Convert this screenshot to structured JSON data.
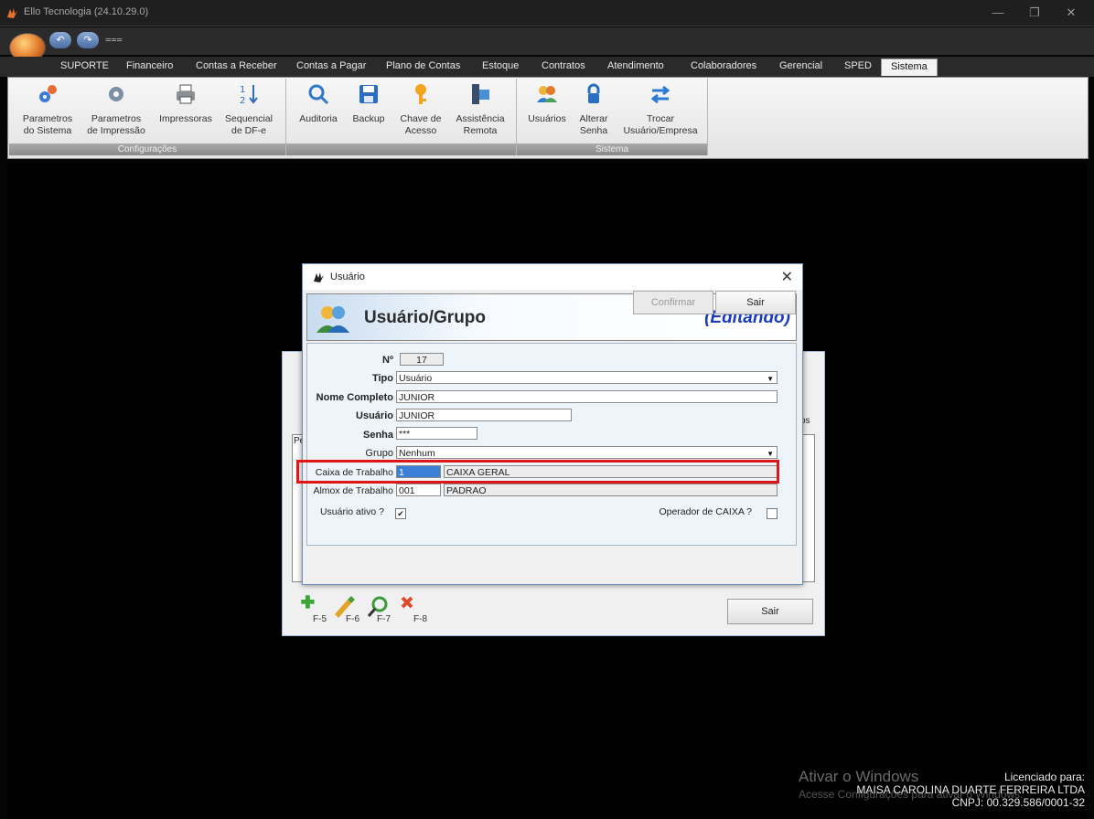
{
  "window": {
    "title": "Ello Tecnologia (24.10.29.0)",
    "minimize": "—",
    "restore": "❐",
    "close": "✕"
  },
  "qat": {
    "undo": "↶",
    "redo": "↷",
    "more": "⩶"
  },
  "tabs": [
    {
      "label": "SUPORTE"
    },
    {
      "label": "Financeiro"
    },
    {
      "label": "Contas a Receber"
    },
    {
      "label": "Contas a Pagar"
    },
    {
      "label": "Plano de Contas"
    },
    {
      "label": "Estoque"
    },
    {
      "label": "Contratos"
    },
    {
      "label": "Atendimento"
    },
    {
      "label": "Colaboradores"
    },
    {
      "label": "Gerencial"
    },
    {
      "label": "SPED"
    },
    {
      "label": "Sistema"
    }
  ],
  "ribbon": {
    "groups": [
      {
        "label": "Configurações"
      },
      {
        "label": ""
      },
      {
        "label": "Sistema"
      }
    ],
    "buttons": [
      {
        "line1": "Parametros",
        "line2": "do Sistema"
      },
      {
        "line1": "Parametros",
        "line2": "de Impressão"
      },
      {
        "line1": "Impressoras",
        "line2": ""
      },
      {
        "line1": "Sequencial",
        "line2": "de DF-e"
      },
      {
        "line1": "Auditoria",
        "line2": ""
      },
      {
        "line1": "Backup",
        "line2": ""
      },
      {
        "line1": "Chave de",
        "line2": "Acesso"
      },
      {
        "line1": "Assistência",
        "line2": "Remota"
      },
      {
        "line1": "Usuários",
        "line2": ""
      },
      {
        "line1": "Alterar",
        "line2": "Senha"
      },
      {
        "line1": "Trocar",
        "line2": "Usuário/Empresa"
      }
    ]
  },
  "background_window": {
    "keys": [
      "F-5",
      "F-6",
      "F-7",
      "F-8"
    ],
    "sair_label": "Sair",
    "partial_left": "Pe",
    "partial_right": "os"
  },
  "dialog": {
    "title": "Usuário",
    "close": "✕",
    "banner_title": "Usuário/Grupo",
    "banner_status": "(Editando)",
    "fields": {
      "numero_label": "Nº",
      "numero_value": "17",
      "tipo_label": "Tipo",
      "tipo_value": "Usuário",
      "nome_label": "Nome Completo",
      "nome_value": "JUNIOR",
      "usuario_label": "Usuário",
      "usuario_value": "JUNIOR",
      "senha_label": "Senha",
      "senha_value": "***",
      "grupo_label": "Grupo",
      "grupo_value": "Nenhum",
      "caixa_label": "Caixa de Trabalho",
      "caixa_code": "1",
      "caixa_name": "CAIXA GERAL",
      "almox_label": "Almox de Trabalho",
      "almox_code": "001",
      "almox_name": "PADRAO",
      "ativo_label": "Usuário ativo ?",
      "operador_label": "Operador de CAIXA ?"
    },
    "confirm_label": "Confirmar",
    "exit_label": "Sair"
  },
  "watermark": {
    "line1": "Ativar o Windows",
    "line2": "Acesse Configurações para ativar o Windows."
  },
  "license": {
    "line1": "Licenciado para:",
    "line2": "MAISA CAROLINA DUARTE FERREIRA LTDA",
    "line3": "CNPJ: 00.329.586/0001-32"
  }
}
